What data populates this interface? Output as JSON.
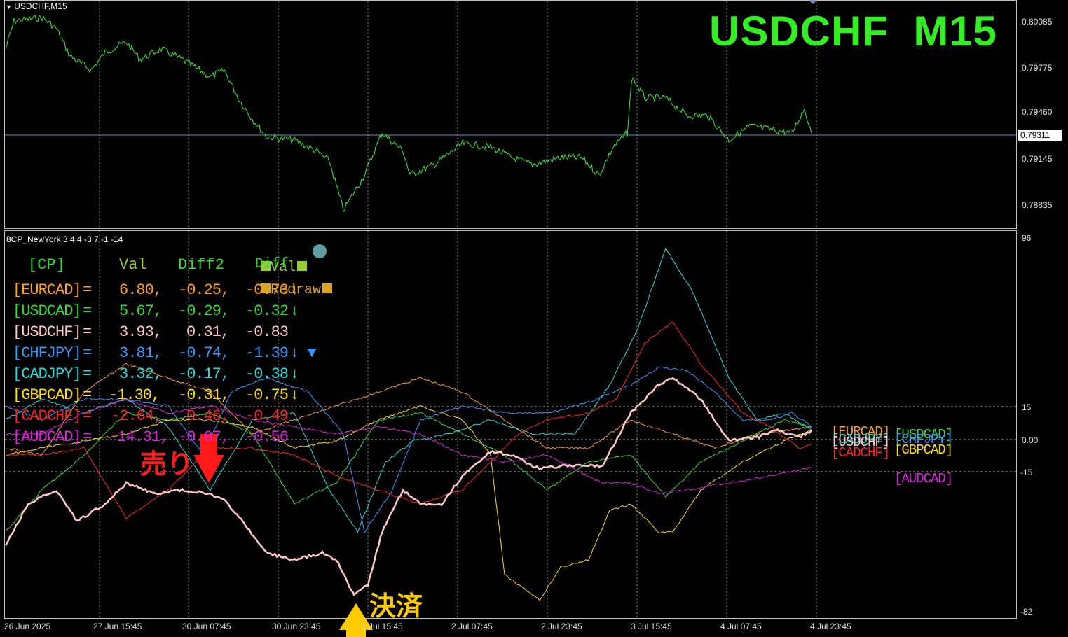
{
  "chart_header": {
    "symbol_label": "USDCHF,M15"
  },
  "overlay_title": "USDCHF  M15",
  "price_axis": [
    "0.80085",
    "0.79775",
    "0.79460",
    "0.79145",
    "0.78835"
  ],
  "current_price": "0.79311",
  "indicator": {
    "name": "8CP_NewYork 3 4 4 -3 7 -1 -14",
    "scale_top": "96",
    "scale_15": "15",
    "scale_0": "0.00",
    "scale_m15": "-15",
    "scale_bottom": "-82",
    "legend": {
      "val": "Val",
      "diff": "Diff",
      "redraw": "Redraw"
    },
    "table_header": {
      "cp": "[CP]",
      "val": "Val",
      "diff2": "Diff2"
    },
    "rows": [
      {
        "pair": "[EURCAD]",
        "eq": "=",
        "val": "6.80,",
        "diff2": "-0.25,",
        "diff": "-0.73",
        "arrow": "↓",
        "color": "#ff9f1c"
      },
      {
        "pair": "[USDCAD]",
        "eq": "=",
        "val": "5.67,",
        "diff2": "-0.29,",
        "diff": "-0.32",
        "arrow": "↓",
        "color": "#33dd33"
      },
      {
        "pair": "[USDCHF]",
        "eq": "=",
        "val": "3.93,",
        "diff2": "0.31,",
        "diff": "-0.83",
        "arrow": "",
        "color": "#ffc8c8"
      },
      {
        "pair": "[CHFJPY]",
        "eq": "=",
        "val": "3.81,",
        "diff2": "-0.74,",
        "diff": "-1.39",
        "arrow": "↓ ▼",
        "color": "#3399ff"
      },
      {
        "pair": "[CADJPY]",
        "eq": "=",
        "val": "3.32,",
        "diff2": "-0.17,",
        "diff": "-0.38",
        "arrow": "↓",
        "color": "#22dddd"
      },
      {
        "pair": "[GBPCAD]",
        "eq": "=",
        "val": "-1.30,",
        "diff2": "-0.31,",
        "diff": "-0.75",
        "arrow": "↓",
        "color": "#ffe000"
      },
      {
        "pair": "[CADCHF]",
        "eq": "=",
        "val": "-2.64,",
        "diff2": "0.46,",
        "diff": "-0.49",
        "arrow": "",
        "color": "#ff2222"
      },
      {
        "pair": "[AUDCAD]",
        "eq": "=",
        "val": "-14.31,",
        "diff2": "-0.07,",
        "diff": "-0.56",
        "arrow": "",
        "color": "#e020e0"
      }
    ],
    "pair_tags": {
      "eurcad": "[EURCAD]",
      "usdcad": "[USDCAD]",
      "cadjpy": "[CADJPY]",
      "chfjpy": "[CHFJPY]",
      "usdchf": "[USDCHF]",
      "cadchf": "[CADCHF]",
      "gbpcad": "[GBPCAD]",
      "audcad": "[AUDCAD]"
    }
  },
  "annotations": {
    "sell": "売り",
    "settle": "決済"
  },
  "time_axis": [
    "26 Jun 2025",
    "27 Jun 15:45",
    "30 Jun 07:45",
    "30 Jun 23:45",
    "1 Jul 15:45",
    "2 Jul 07:45",
    "2 Jul 23:45",
    "3 Jul 15:45",
    "4 Jul 07:45",
    "4 Jul 23:45"
  ],
  "colors": {
    "price_line": "#33ee33",
    "title": "#33ee22",
    "eurcad": "#ff9f1c",
    "usdcad": "#33dd33",
    "usdchf": "#ffc8c8",
    "chfjpy": "#3399ff",
    "cadjpy": "#22dddd",
    "gbpcad": "#ffe000",
    "cadchf": "#ff2222",
    "audcad": "#e020e0",
    "sell_arrow": "#ff1a1a",
    "settle_arrow": "#ffcc00"
  }
}
